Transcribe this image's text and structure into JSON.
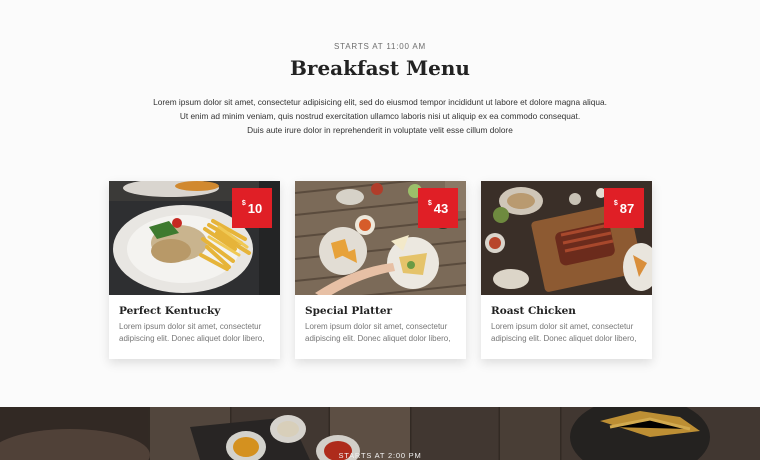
{
  "breakfast": {
    "eyebrow": "STARTS AT 11:00 AM",
    "title": "Breakfast Menu",
    "lead": [
      "Lorem ipsum dolor sit amet, consectetur adipisicing elit, sed do eiusmod tempor incididunt ut labore et dolore magna aliqua.",
      "Ut enim ad minim veniam, quis nostrud exercitation ullamco laboris nisi ut aliquip ex ea commodo consequat.",
      "Duis aute irure dolor in reprehenderit in voluptate velit esse cillum dolore"
    ]
  },
  "items": [
    {
      "name": "Perfect Kentucky",
      "currency": "$",
      "price": "10",
      "desc": [
        "Lorem ipsum dolor sit amet, consectetur",
        "adipiscing elit. Donec aliquet dolor libero,"
      ]
    },
    {
      "name": "Special Platter",
      "currency": "$",
      "price": "43",
      "desc": [
        "Lorem ipsum dolor sit amet, consectetur",
        "adipiscing elit. Donec aliquet dolor libero,"
      ]
    },
    {
      "name": "Roast Chicken",
      "currency": "$",
      "price": "87",
      "desc": [
        "Lorem ipsum dolor sit amet, consectetur",
        "adipiscing elit. Donec aliquet dolor libero,"
      ]
    }
  ],
  "next_section": {
    "eyebrow": "STARTS AT 2:00 PM"
  },
  "colors": {
    "accent": "#e01f26",
    "background": "#fbfbfb"
  }
}
